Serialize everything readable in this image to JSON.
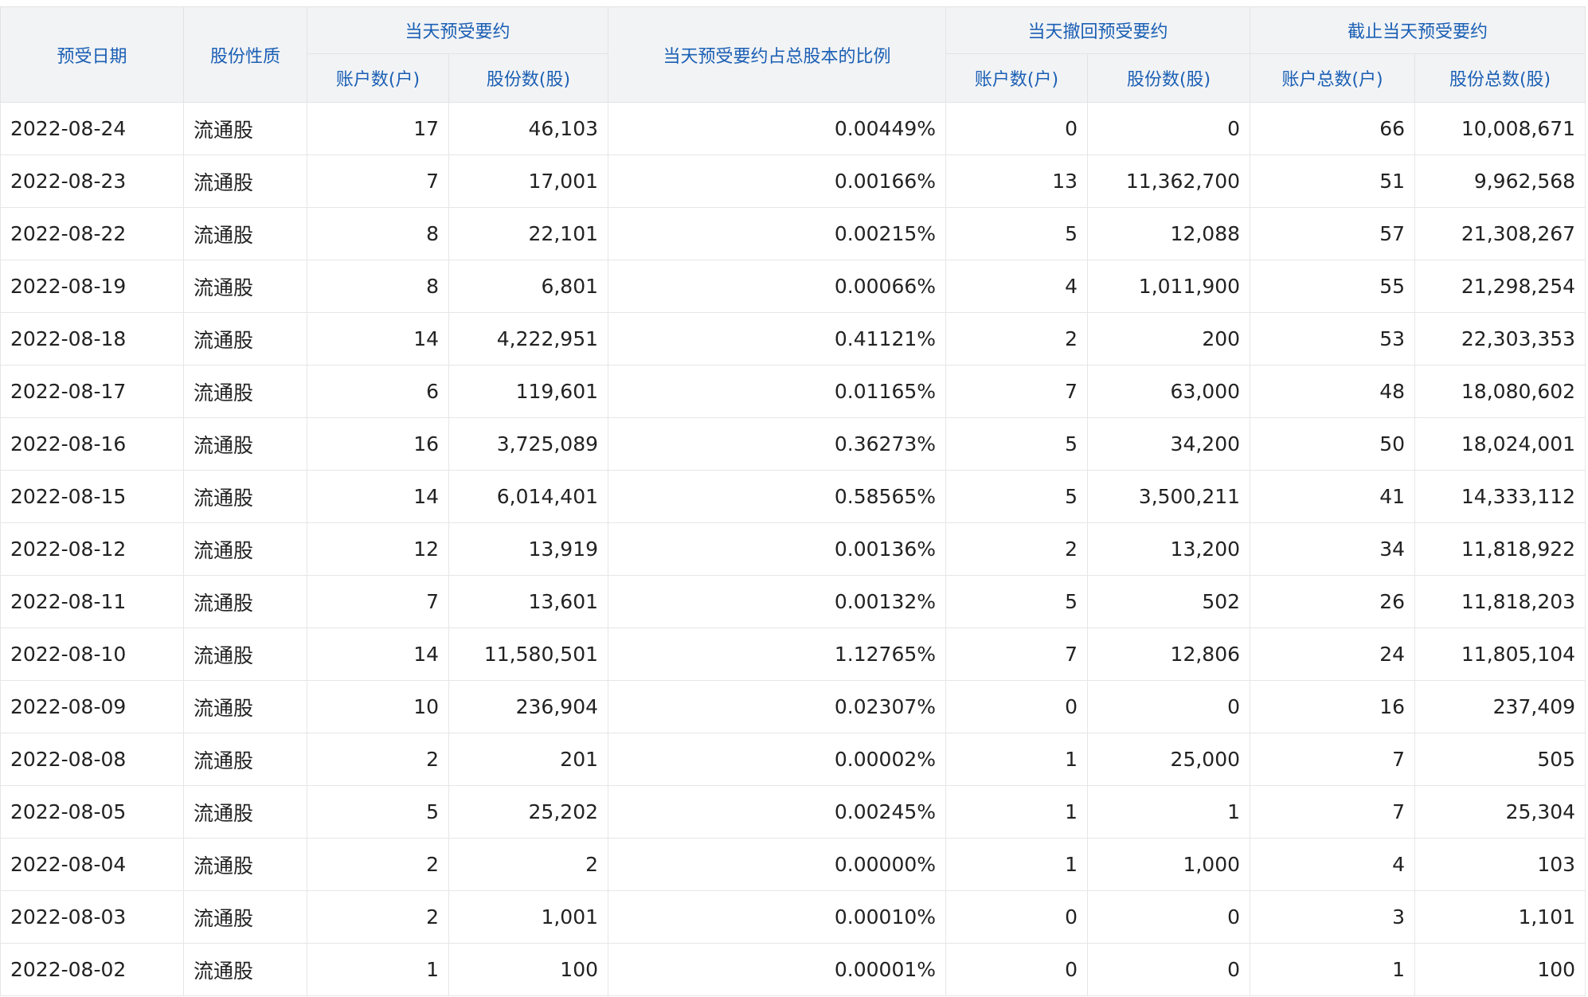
{
  "headers": {
    "date": "预受日期",
    "share_type": "股份性质",
    "today_accept": "当天预受要约",
    "ratio": "当天预受要约占总股本的比例",
    "today_withdraw": "当天撤回预受要约",
    "cumulative": "截止当天预受要约",
    "accounts": "账户数(户)",
    "shares": "股份数(股)",
    "total_accounts": "账户总数(户)",
    "total_shares": "股份总数(股)"
  },
  "columns": [
    "date",
    "share_type",
    "accept_accounts",
    "accept_shares",
    "ratio",
    "withdraw_accounts",
    "withdraw_shares",
    "total_accounts",
    "total_shares"
  ],
  "rows": [
    [
      "2022-08-24",
      "流通股",
      "17",
      "46,103",
      "0.00449%",
      "0",
      "0",
      "66",
      "10,008,671"
    ],
    [
      "2022-08-23",
      "流通股",
      "7",
      "17,001",
      "0.00166%",
      "13",
      "11,362,700",
      "51",
      "9,962,568"
    ],
    [
      "2022-08-22",
      "流通股",
      "8",
      "22,101",
      "0.00215%",
      "5",
      "12,088",
      "57",
      "21,308,267"
    ],
    [
      "2022-08-19",
      "流通股",
      "8",
      "6,801",
      "0.00066%",
      "4",
      "1,011,900",
      "55",
      "21,298,254"
    ],
    [
      "2022-08-18",
      "流通股",
      "14",
      "4,222,951",
      "0.41121%",
      "2",
      "200",
      "53",
      "22,303,353"
    ],
    [
      "2022-08-17",
      "流通股",
      "6",
      "119,601",
      "0.01165%",
      "7",
      "63,000",
      "48",
      "18,080,602"
    ],
    [
      "2022-08-16",
      "流通股",
      "16",
      "3,725,089",
      "0.36273%",
      "5",
      "34,200",
      "50",
      "18,024,001"
    ],
    [
      "2022-08-15",
      "流通股",
      "14",
      "6,014,401",
      "0.58565%",
      "5",
      "3,500,211",
      "41",
      "14,333,112"
    ],
    [
      "2022-08-12",
      "流通股",
      "12",
      "13,919",
      "0.00136%",
      "2",
      "13,200",
      "34",
      "11,818,922"
    ],
    [
      "2022-08-11",
      "流通股",
      "7",
      "13,601",
      "0.00132%",
      "5",
      "502",
      "26",
      "11,818,203"
    ],
    [
      "2022-08-10",
      "流通股",
      "14",
      "11,580,501",
      "1.12765%",
      "7",
      "12,806",
      "24",
      "11,805,104"
    ],
    [
      "2022-08-09",
      "流通股",
      "10",
      "236,904",
      "0.02307%",
      "0",
      "0",
      "16",
      "237,409"
    ],
    [
      "2022-08-08",
      "流通股",
      "2",
      "201",
      "0.00002%",
      "1",
      "25,000",
      "7",
      "505"
    ],
    [
      "2022-08-05",
      "流通股",
      "5",
      "25,202",
      "0.00245%",
      "1",
      "1",
      "7",
      "25,304"
    ],
    [
      "2022-08-04",
      "流通股",
      "2",
      "2",
      "0.00000%",
      "1",
      "1,000",
      "4",
      "103"
    ],
    [
      "2022-08-03",
      "流通股",
      "2",
      "1,001",
      "0.00010%",
      "0",
      "0",
      "3",
      "1,101"
    ],
    [
      "2022-08-02",
      "流通股",
      "1",
      "100",
      "0.00001%",
      "0",
      "0",
      "1",
      "100"
    ]
  ],
  "colors": {
    "header_text": "#1a5fb4",
    "header_bg": "#f2f3f5",
    "body_text": "#222222",
    "border": "#e6e6e6"
  }
}
